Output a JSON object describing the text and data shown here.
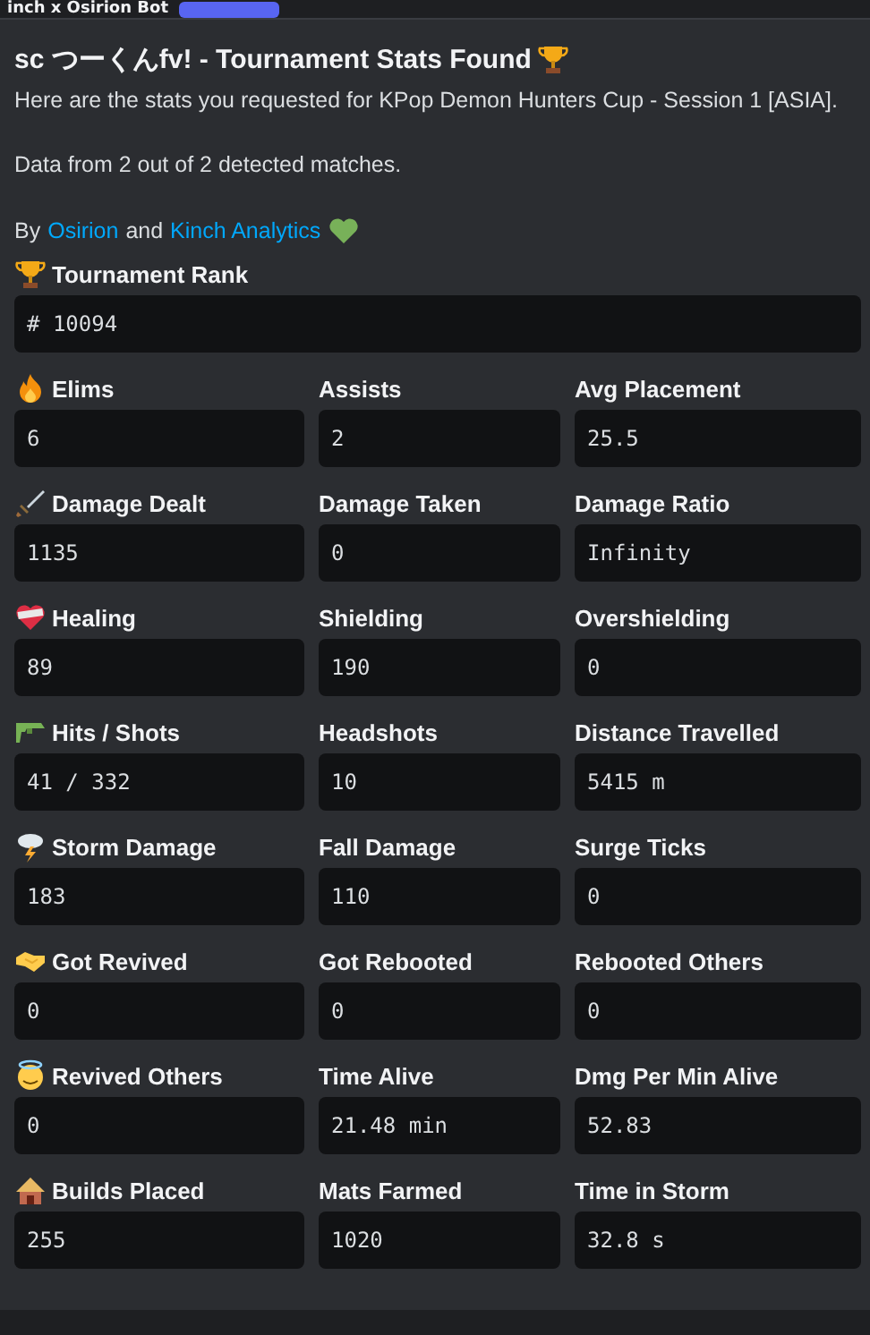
{
  "header": {
    "author": "inch x Osirion Bot"
  },
  "embed": {
    "title": "sc つーくんfv! - Tournament Stats Found",
    "lines": [
      "Here are the stats you requested for KPop Demon Hunters Cup - Session 1 [ASIA].",
      "Data from 2 out of 2 detected matches."
    ],
    "credits": {
      "prefix": "By",
      "links": [
        "Osirion",
        "Kinch Analytics"
      ],
      "joiner": "and"
    },
    "fields": [
      {
        "label": "Tournament Rank",
        "value": "# 10094",
        "kind": "full"
      },
      {
        "label": "Elims",
        "value": "6",
        "kind": "inline"
      },
      {
        "label": "Assists",
        "value": "2",
        "kind": "inline"
      },
      {
        "label": "Avg Placement",
        "value": "25.5",
        "kind": "inline"
      },
      {
        "label": "Damage Dealt",
        "value": "1135",
        "kind": "inline"
      },
      {
        "label": "Damage Taken",
        "value": "0",
        "kind": "inline"
      },
      {
        "label": "Damage Ratio",
        "value": "Infinity",
        "kind": "inline"
      },
      {
        "label": "Healing",
        "value": "89",
        "kind": "inline"
      },
      {
        "label": "Shielding",
        "value": "190",
        "kind": "inline"
      },
      {
        "label": "Overshielding",
        "value": "0",
        "kind": "inline"
      },
      {
        "label": "Hits / Shots",
        "value": "41 / 332",
        "kind": "inline"
      },
      {
        "label": "Headshots",
        "value": "10",
        "kind": "inline"
      },
      {
        "label": "Distance Travelled",
        "value": "5415 m",
        "kind": "inline"
      },
      {
        "label": "Storm Damage",
        "value": "183",
        "kind": "inline"
      },
      {
        "label": "Fall Damage",
        "value": "110",
        "kind": "inline"
      },
      {
        "label": "Surge Ticks",
        "value": "0",
        "kind": "inline"
      },
      {
        "label": "Got Revived",
        "value": "0",
        "kind": "inline"
      },
      {
        "label": "Got Rebooted",
        "value": "0",
        "kind": "inline"
      },
      {
        "label": "Rebooted Others",
        "value": "0",
        "kind": "inline"
      },
      {
        "label": "Revived Others",
        "value": "0",
        "kind": "inline"
      },
      {
        "label": "Time Alive",
        "value": "21.48 min",
        "kind": "inline"
      },
      {
        "label": "Dmg Per Min Alive",
        "value": "52.83",
        "kind": "inline"
      },
      {
        "label": "Builds Placed",
        "value": "255",
        "kind": "inline"
      },
      {
        "label": "Mats Farmed",
        "value": "1020",
        "kind": "inline"
      },
      {
        "label": "Time in Storm",
        "value": "32.8 s",
        "kind": "inline"
      }
    ]
  }
}
